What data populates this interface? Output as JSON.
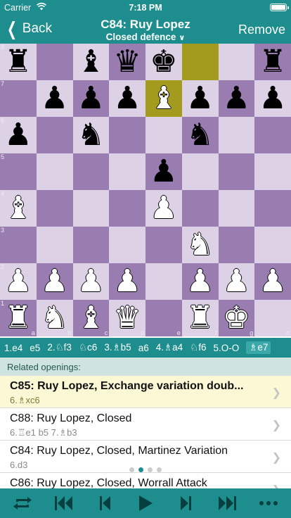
{
  "status": {
    "carrier": "Carrier",
    "time": "7:18 PM"
  },
  "header": {
    "back_label": "Back",
    "title": "C84: Ruy Lopez",
    "subtitle": "Closed defence",
    "remove_label": "Remove"
  },
  "board": {
    "rank_labels": [
      "8",
      "7",
      "6",
      "5",
      "4",
      "3",
      "2",
      "1"
    ],
    "file_labels": [
      "a",
      "b",
      "c",
      "d",
      "e",
      "f",
      "g",
      "h"
    ],
    "highlight": [
      "e7",
      "f8"
    ],
    "position": [
      [
        "bR",
        "",
        "bB",
        "bQ",
        "bK",
        "",
        "",
        "bR"
      ],
      [
        "",
        "bP",
        "bP",
        "bP",
        "wB",
        "bP",
        "bP",
        "bP"
      ],
      [
        "bP",
        "",
        "bN",
        "",
        "",
        "bN",
        "",
        ""
      ],
      [
        "",
        "",
        "",
        "",
        "bP",
        "",
        "",
        ""
      ],
      [
        "wB",
        "",
        "",
        "",
        "wP",
        "",
        "",
        ""
      ],
      [
        "",
        "",
        "",
        "",
        "",
        "wN",
        "",
        ""
      ],
      [
        "wP",
        "wP",
        "wP",
        "wP",
        "",
        "wP",
        "wP",
        "wP"
      ],
      [
        "wR",
        "wN",
        "wB",
        "wQ",
        "",
        "wR",
        "wK",
        ""
      ]
    ]
  },
  "moves": [
    "1.e4",
    "e5",
    "2.♘f3",
    "♘c6",
    "3.♗b5",
    "a6",
    "4.♗a4",
    "♘f6",
    "5.O-O",
    "♗e7"
  ],
  "current_move_index": 9,
  "related": {
    "header": "Related openings:",
    "items": [
      {
        "name": "C85: Ruy Lopez, Exchange variation doub...",
        "line": "6.♗xc6",
        "selected": true
      },
      {
        "name": "C88: Ruy Lopez, Closed",
        "line": "6.♖e1 b5 7.♗b3",
        "selected": false
      },
      {
        "name": "C84: Ruy Lopez, Closed, Martinez Variation",
        "line": "6.d3",
        "selected": false
      },
      {
        "name": "C86: Ruy Lopez, Closed, Worrall Attack",
        "line": "",
        "selected": false
      }
    ],
    "page_count": 4,
    "page_index": 1
  },
  "toolbar": {
    "buttons": [
      "flip-board-icon",
      "first-move-icon",
      "previous-move-icon",
      "play-icon",
      "next-move-icon",
      "last-move-icon",
      "more-icon"
    ]
  },
  "colors": {
    "accent": "#1e8d8d",
    "light_square": "#dcd1e5",
    "dark_square": "#9a7db0",
    "highlight": "#a39b1e"
  }
}
